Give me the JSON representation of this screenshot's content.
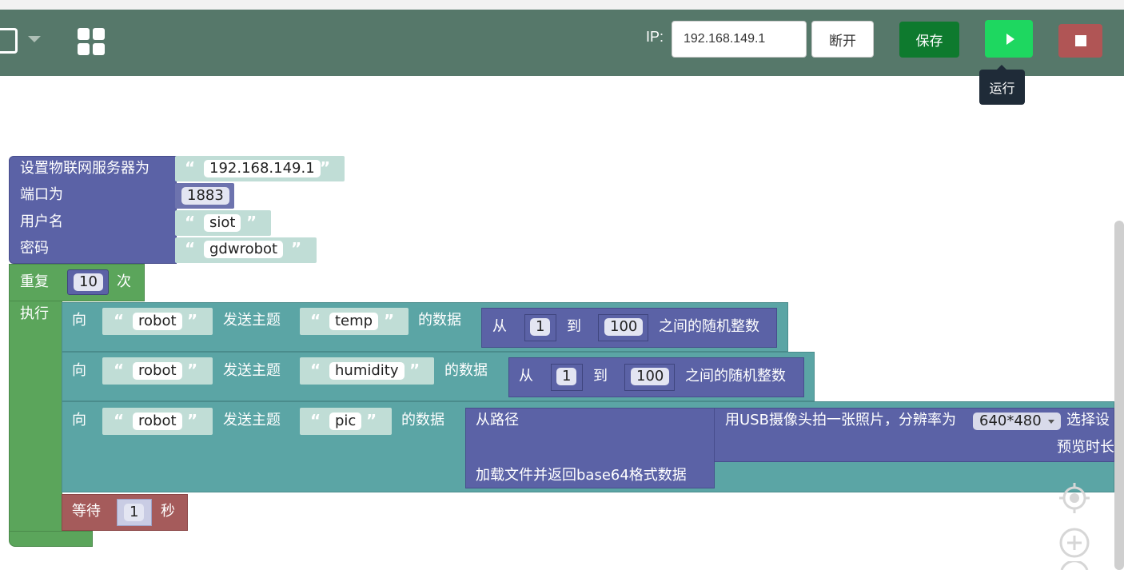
{
  "toolbar": {
    "ip_label": "IP:",
    "ip_value": "192.168.149.1",
    "disconnect_label": "断开",
    "save_label": "保存",
    "run_tooltip": "运行",
    "colors": {
      "toolbar_bg": "#56786a",
      "save": "#0e7a2e",
      "run": "#1ed760",
      "stop": "#b05555"
    }
  },
  "workspace": {
    "iot_block": {
      "title": "设置物联网服务器为",
      "server": "192.168.149.1",
      "port_label": "端口为",
      "port": "1883",
      "user_label": "用户名",
      "user": "siot",
      "pass_label": "密码",
      "pass": "gdwrobot"
    },
    "repeat_block": {
      "label": "重复",
      "count": "10",
      "times": "次",
      "do": "执行"
    },
    "send_blocks": [
      {
        "to": "向",
        "target": "robot",
        "topic_label": "发送主题",
        "topic": "temp",
        "data_label": "的数据",
        "from": "从",
        "min": "1",
        "to_word": "到",
        "max": "100",
        "rand": "之间的随机整数"
      },
      {
        "to": "向",
        "target": "robot",
        "topic_label": "发送主题",
        "topic": "humidity",
        "data_label": "的数据",
        "from": "从",
        "min": "1",
        "to_word": "到",
        "max": "100",
        "rand": "之间的随机整数"
      },
      {
        "to": "向",
        "target": "robot",
        "topic_label": "发送主题",
        "topic": "pic",
        "data_label": "的数据",
        "path_label": "从路径",
        "load_label": "加载文件并返回base64格式数据",
        "camera_label": "用USB摄像头拍一张照片，分辨率为",
        "resolution": "640*480",
        "select_label": "选择设",
        "preview_label": "预览时长"
      }
    ],
    "wait_block": {
      "label": "等待",
      "value": "1",
      "unit": "秒"
    }
  },
  "icons": [
    "file-icon",
    "dropdown-caret-icon",
    "grid-icon",
    "play-icon",
    "stop-icon",
    "recenter-icon",
    "zoom-in-icon",
    "zoom-out-icon"
  ]
}
